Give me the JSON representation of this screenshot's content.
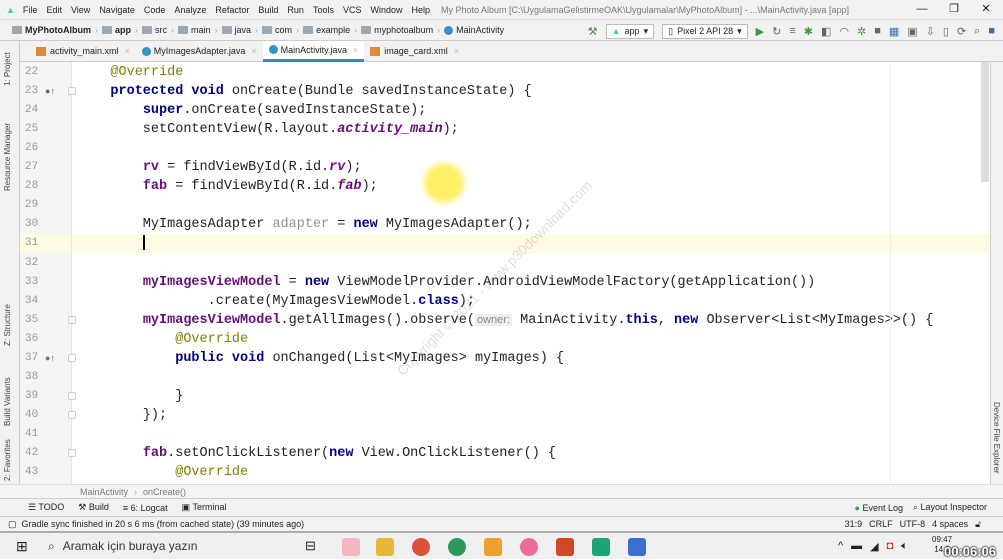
{
  "menu": {
    "items": [
      "File",
      "Edit",
      "View",
      "Navigate",
      "Code",
      "Analyze",
      "Refactor",
      "Build",
      "Run",
      "Tools",
      "VCS",
      "Window",
      "Help"
    ],
    "title": "My Photo Album [C:\\UygulamaGelistirmeOAK\\Uygulamalar\\MyPhotoAlbum] - ...\\MainActivity.java [app]"
  },
  "nav": {
    "crumbs": [
      "MyPhotoAlbum",
      "app",
      "src",
      "main",
      "java",
      "com",
      "example",
      "myphotoalbum",
      "MainActivity"
    ],
    "run_config": "app",
    "device": "Pixel 2 API 28"
  },
  "tabs": [
    {
      "label": "activity_main.xml",
      "type": "xml"
    },
    {
      "label": "MyImagesAdapter.java",
      "type": "java"
    },
    {
      "label": "MainActivity.java",
      "type": "java",
      "active": true
    },
    {
      "label": "image_card.xml",
      "type": "xml"
    }
  ],
  "side": {
    "left": [
      "1: Project",
      "Resource Manager",
      "Z: Structure",
      "Build Variants",
      "2: Favorites"
    ],
    "right": [
      "Device File Explorer"
    ]
  },
  "editor": {
    "current_line": 31,
    "lines": [
      {
        "n": 22,
        "t": [
          [
            "    "
          ],
          [
            "@Override",
            "an"
          ]
        ]
      },
      {
        "n": 23,
        "t": [
          [
            "    "
          ],
          [
            "protected void",
            "kw"
          ],
          [
            " onCreate(Bundle savedInstanceState) {"
          ]
        ]
      },
      {
        "n": 24,
        "t": [
          [
            "        "
          ],
          [
            "super",
            "kw"
          ],
          [
            ".onCreate(savedInstanceState);"
          ]
        ]
      },
      {
        "n": 25,
        "t": [
          [
            "        setContentView(R.layout."
          ],
          [
            "activity_main",
            "sf"
          ],
          [
            ");"
          ]
        ]
      },
      {
        "n": 26,
        "t": []
      },
      {
        "n": 27,
        "t": [
          [
            "        "
          ],
          [
            "rv",
            "fd"
          ],
          [
            " = findViewById(R.id."
          ],
          [
            "rv",
            "sf"
          ],
          [
            ");"
          ]
        ]
      },
      {
        "n": 28,
        "t": [
          [
            "        "
          ],
          [
            "fab",
            "fd"
          ],
          [
            " = findViewById(R.id."
          ],
          [
            "fab",
            "sf"
          ],
          [
            ");"
          ]
        ]
      },
      {
        "n": 29,
        "t": []
      },
      {
        "n": 30,
        "t": [
          [
            "        MyImagesAdapter "
          ],
          [
            "adapter",
            "un"
          ],
          [
            " = "
          ],
          [
            "new",
            "kw"
          ],
          [
            " MyImagesAdapter();"
          ]
        ]
      },
      {
        "n": 31,
        "t": [
          [
            "        "
          ]
        ]
      },
      {
        "n": 32,
        "t": []
      },
      {
        "n": 33,
        "t": [
          [
            "        "
          ],
          [
            "myImagesViewModel",
            "fd"
          ],
          [
            " = "
          ],
          [
            "new",
            "kw"
          ],
          [
            " ViewModelProvider.AndroidViewModelFactory(getApplication())"
          ]
        ]
      },
      {
        "n": 34,
        "t": [
          [
            "                .create(MyImagesViewModel."
          ],
          [
            "class",
            "kw"
          ],
          [
            ");"
          ]
        ]
      },
      {
        "n": 35,
        "t": [
          [
            "        "
          ],
          [
            "myImagesViewModel",
            "fd"
          ],
          [
            ".getAllImages().observe("
          ],
          [
            "owner:",
            "hint"
          ],
          [
            " MainActivity."
          ],
          [
            "this",
            "kw"
          ],
          [
            ", "
          ],
          [
            "new",
            "kw"
          ],
          [
            " Observer<List<MyImages>>() {"
          ]
        ]
      },
      {
        "n": 36,
        "t": [
          [
            "            "
          ],
          [
            "@Override",
            "an"
          ]
        ]
      },
      {
        "n": 37,
        "t": [
          [
            "            "
          ],
          [
            "public void",
            "kw"
          ],
          [
            " onChanged(List<MyImages> myImages) {"
          ]
        ]
      },
      {
        "n": 38,
        "t": []
      },
      {
        "n": 39,
        "t": [
          [
            "            }"
          ]
        ]
      },
      {
        "n": 40,
        "t": [
          [
            "        });"
          ]
        ]
      },
      {
        "n": 41,
        "t": []
      },
      {
        "n": 42,
        "t": [
          [
            "        "
          ],
          [
            "fab",
            "fd"
          ],
          [
            ".setOnClickListener("
          ],
          [
            "new",
            "kw"
          ],
          [
            " View.OnClickListener() {"
          ]
        ]
      },
      {
        "n": 43,
        "t": [
          [
            "            "
          ],
          [
            "@Override",
            "an"
          ]
        ]
      }
    ]
  },
  "watermark": "Copyright © 2021 - www.p30download.com",
  "breadcrumb": [
    "MainActivity",
    "onCreate()"
  ],
  "toolwindows": [
    "TODO",
    "Build",
    "6: Logcat",
    "Terminal"
  ],
  "toolwindows_right": [
    "Event Log",
    "Layout Inspector"
  ],
  "status": {
    "message": "Gradle sync finished in 20 s 6 ms (from cached state) (39 minutes ago)",
    "position": "31:9",
    "line_sep": "CRLF",
    "encoding": "UTF-8",
    "indent": "4 spaces"
  },
  "taskbar": {
    "search_placeholder": "Aramak için buraya yazın",
    "time": "09:47",
    "date": "14.0",
    "overlay_timer": "00:06:06"
  }
}
